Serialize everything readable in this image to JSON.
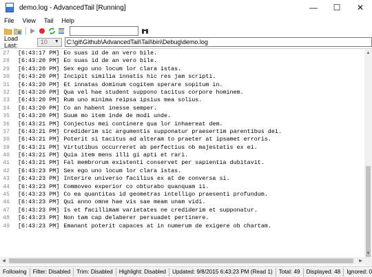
{
  "window": {
    "title": "demo.log - AdvancedTail [Running]",
    "minimize": "—",
    "maximize": "☐",
    "close": "✕"
  },
  "menu": [
    "File",
    "View",
    "Tail",
    "Help"
  ],
  "toolbar": {
    "search_value": ""
  },
  "loadbar": {
    "label": "Load Last:",
    "selected": "10",
    "path": "C:\\git\\Github\\AdvancedTail\\Tail\\bin\\Debug\\demo.log"
  },
  "log": [
    {
      "n": "27",
      "t": "[6:43:17 PM]",
      "m": "Eo suas id de an vero bile."
    },
    {
      "n": "28",
      "t": "[6:43:20 PM]",
      "m": "Eo suas id de an vero bile."
    },
    {
      "n": "29",
      "t": "[6:43:20 PM]",
      "m": "Sex ego uno locum lor clara istas."
    },
    {
      "n": "30",
      "t": "[6:43:20 PM]",
      "m": "Incipit similia innatis hic res jam scripti."
    },
    {
      "n": "31",
      "t": "[6:43:20 PM]",
      "m": "Et innatas dominum cogitem sperare sopitum in."
    },
    {
      "n": "32",
      "t": "[6:43:20 PM]",
      "m": "Qua vel hae student suppono tacitus corpore hominem."
    },
    {
      "n": "33",
      "t": "[6:43:20 PM]",
      "m": "Rum uno minima reipsa ipsius mea solius."
    },
    {
      "n": "34",
      "t": "[6:43:20 PM]",
      "m": "Co an habent inesse semper."
    },
    {
      "n": "35",
      "t": "[6:43:20 PM]",
      "m": "Suum mo item inde de modi unde."
    },
    {
      "n": "36",
      "t": "[6:43:21 PM]",
      "m": "Conjectus mei continere qua lor inhaereat dem."
    },
    {
      "n": "37",
      "t": "[6:43:21 PM]",
      "m": "Crediderim sic argumentis supponatur praesertim parentibus dei."
    },
    {
      "n": "38",
      "t": "[6:43:21 PM]",
      "m": "Poterit si tacitus ad alteram to praeter at ipsamet erroris."
    },
    {
      "n": "39",
      "t": "[6:43:21 PM]",
      "m": "Virtutibus occurreret ab perfectius ob majestatis ex ei."
    },
    {
      "n": "40",
      "t": "[6:43:21 PM]",
      "m": "Quia item mens illi gi apti et rari."
    },
    {
      "n": "41",
      "t": "[6:43:21 PM]",
      "m": "Fal membrorum existenti conservet per sapientia dubitavit."
    },
    {
      "n": "42",
      "t": "[6:43:23 PM]",
      "m": "Sex ego uno locum lor clara istas."
    },
    {
      "n": "43",
      "t": "[6:43:23 PM]",
      "m": "Interire universo facilius ex at de conversa si."
    },
    {
      "n": "44",
      "t": "[6:43:23 PM]",
      "m": "Commoveo experior co obturabo quanquam ii."
    },
    {
      "n": "45",
      "t": "[6:43:23 PM]",
      "m": "Co ea quantitas id geometras intelligo praesenti profundum."
    },
    {
      "n": "46",
      "t": "[6:43:23 PM]",
      "m": "Qui anno omne hae vis sae meam unam vidi."
    },
    {
      "n": "47",
      "t": "[6:43:23 PM]",
      "m": "Is et facillimam varietates ne crediderim et supponatur."
    },
    {
      "n": "48",
      "t": "[6:43:23 PM]",
      "m": "Non tam cap delaberer persuadet pertinere."
    },
    {
      "n": "49",
      "t": "[6:43:23 PM]",
      "m": "Emanant poterit capaces at in numerum de exigere ob chartam."
    }
  ],
  "status": {
    "following": "Following",
    "filter": "Filter: Disabled",
    "trim": "Trim: Disabled",
    "highlight": "Highlight: Disabled",
    "updated": "Updated: 9/8/2015 6:43:23 PM (Read 1)",
    "total": "Total: 49",
    "displayed": "Displayed: 48",
    "ignored": "Ignored: 0"
  }
}
